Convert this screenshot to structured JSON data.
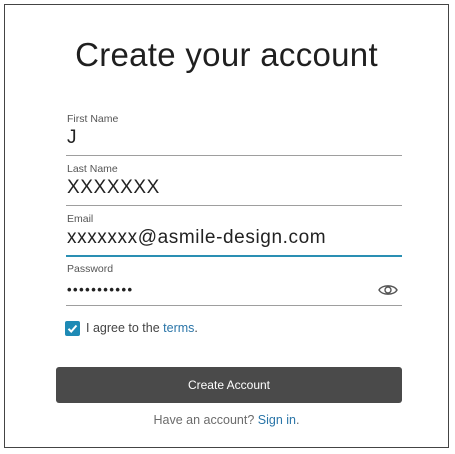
{
  "form": {
    "title": "Create your account",
    "fields": [
      {
        "label": "First Name",
        "value": "J"
      },
      {
        "label": "Last Name",
        "value": "XXXXXXX"
      },
      {
        "label": "Email",
        "value": "xxxxxxx@asmile-design.com"
      },
      {
        "label": "Password",
        "value": "•••••••••••"
      }
    ],
    "agree": {
      "checked": true,
      "prefix": "I agree to the ",
      "link_text": "terms",
      "suffix": "."
    },
    "submit_label": "Create Account",
    "signin": {
      "prefix": "Have an account? ",
      "link_text": "Sign in",
      "suffix": "."
    }
  },
  "colors": {
    "accent": "#2a8fb3",
    "button_bg": "#4a4a4a",
    "link": "#2a75a8"
  },
  "icons": {
    "password_toggle": "eye-icon",
    "checkbox": "checkmark-icon"
  }
}
